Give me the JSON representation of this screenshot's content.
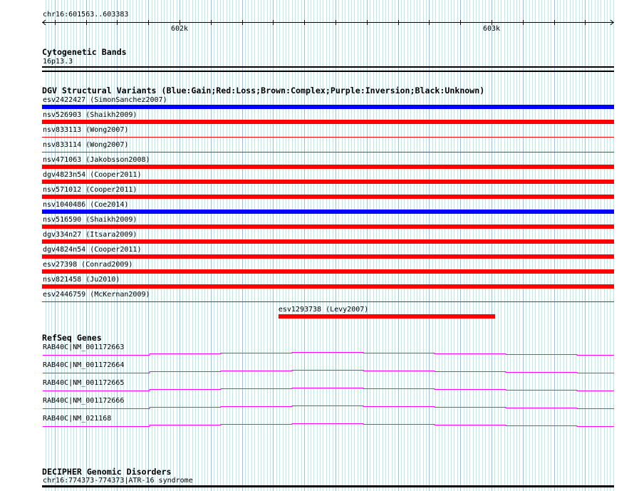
{
  "ruler": {
    "position_label": "chr16:601563..603383",
    "view_start": 601563,
    "view_end": 603383,
    "tick_labels": [
      {
        "pos": 602000,
        "label": "602k"
      },
      {
        "pos": 603000,
        "label": "603k"
      }
    ]
  },
  "cytogenetic_bands": {
    "title": "Cytogenetic Bands",
    "band": "16p13.3"
  },
  "dgv": {
    "title": "DGV Structural Variants (Blue:Gain;Red:Loss;Brown:Complex;Purple:Inversion;Black:Unknown)",
    "colors": {
      "gain": "#0000ff",
      "loss": "#ff0000",
      "complex": "#a04000"
    },
    "variants": [
      {
        "label": "esv2422427 (SimonSanchez2007)",
        "type": "gain",
        "style": "thick"
      },
      {
        "label": "nsv526903 (Shaikh2009)",
        "type": "loss",
        "style": "thick"
      },
      {
        "label": "nsv833113 (Wong2007)",
        "type": "loss",
        "style": "thin"
      },
      {
        "label": "nsv833114 (Wong2007)",
        "type": "complex",
        "style": "thin"
      },
      {
        "label": "nsv471063 (Jakobsson2008)",
        "type": "loss",
        "style": "thick"
      },
      {
        "label": "dgv4823n54 (Cooper2011)",
        "type": "loss",
        "style": "thick"
      },
      {
        "label": "nsv571012 (Cooper2011)",
        "type": "loss",
        "style": "thick"
      },
      {
        "label": "nsv1040486 (Coe2014)",
        "type": "gain",
        "style": "thick"
      },
      {
        "label": "nsv516590 (Shaikh2009)",
        "type": "loss",
        "style": "thick"
      },
      {
        "label": "dgv334n27 (Itsara2009)",
        "type": "loss",
        "style": "thick"
      },
      {
        "label": "dgv4824n54 (Cooper2011)",
        "type": "loss",
        "style": "thick"
      },
      {
        "label": "esv27398 (Conrad2009)",
        "type": "loss",
        "style": "thick"
      },
      {
        "label": "nsv821458 (Ju2010)",
        "type": "loss",
        "style": "thick"
      },
      {
        "label": "esv2446759 (McKernan2009)",
        "type": "loss",
        "style": "thin"
      }
    ],
    "partial_variant": {
      "label": "esv1293738 (Levy2007)",
      "type": "loss",
      "start": 602317,
      "end": 603011
    }
  },
  "refseq": {
    "title": "RefSeq Genes",
    "color": "#ff00ff",
    "genes": [
      "RAB40C|NM_001172663",
      "RAB40C|NM_001172664",
      "RAB40C|NM_001172665",
      "RAB40C|NM_001172666",
      "RAB40C|NM_021168"
    ]
  },
  "decipher": {
    "title": "DECIPHER Genomic Disorders",
    "entry": "chr16:774373-774373|ATR-16 syndrome"
  }
}
